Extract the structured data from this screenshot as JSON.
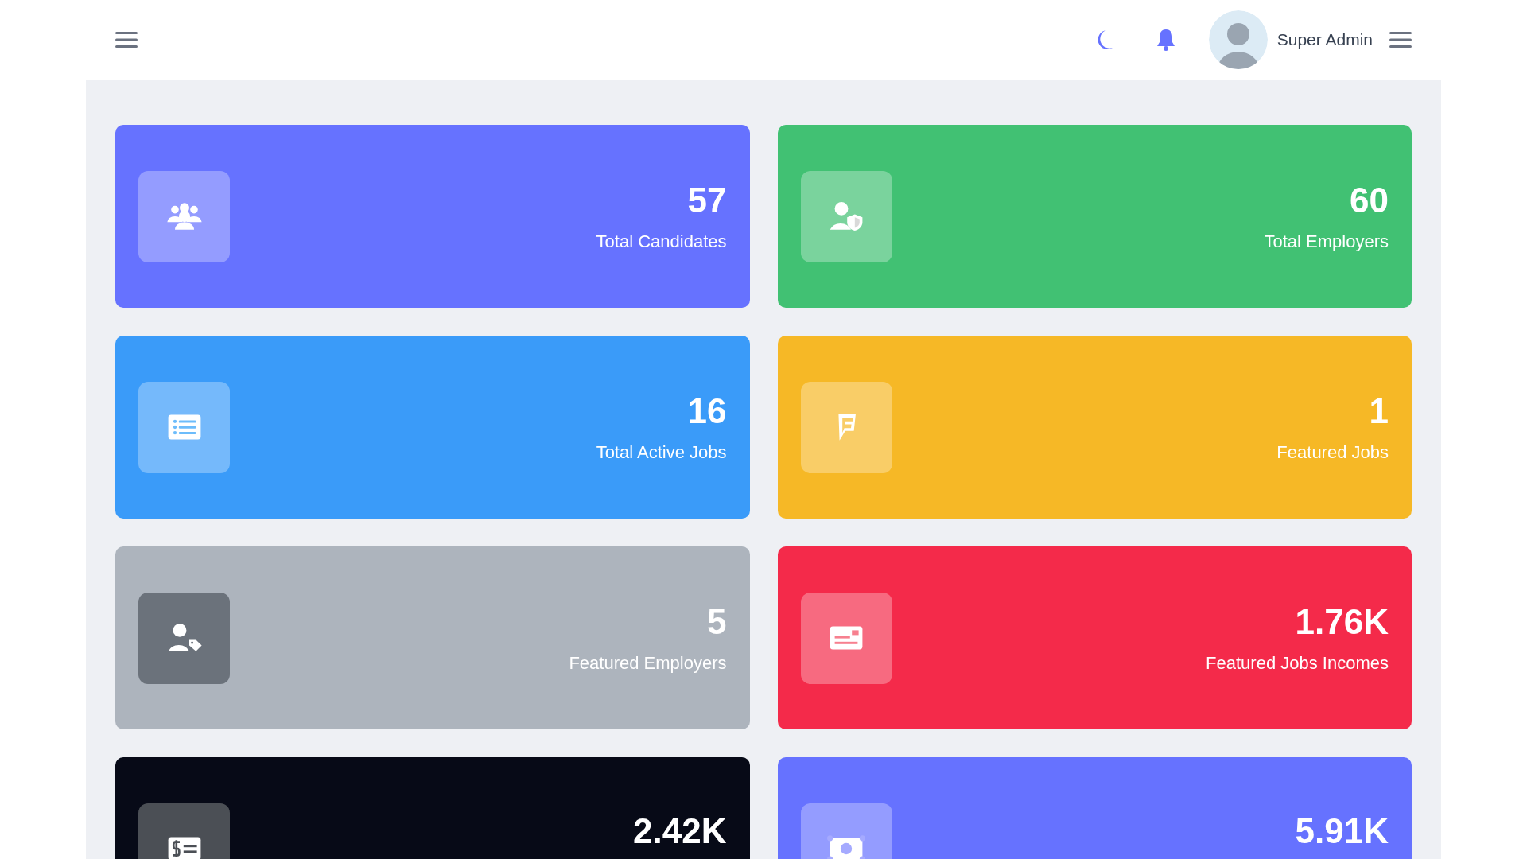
{
  "header": {
    "user_name": "Super Admin"
  },
  "cards": [
    {
      "value": "57",
      "label": "Total Candidates",
      "color": "#6672ff",
      "kind": "users"
    },
    {
      "value": "60",
      "label": "Total Employers",
      "color": "#41c173",
      "kind": "user-shield"
    },
    {
      "value": "16",
      "label": "Total Active Jobs",
      "color": "#3a9bf9",
      "kind": "list"
    },
    {
      "value": "1",
      "label": "Featured Jobs",
      "color": "#f6b826",
      "kind": "flag"
    },
    {
      "value": "5",
      "label": "Featured Employers",
      "color": "#adb4bd",
      "kind": "user-tag"
    },
    {
      "value": "1.76K",
      "label": "Featured Jobs Incomes",
      "color": "#f42a4a",
      "kind": "card"
    },
    {
      "value": "2.42K",
      "color": "#070a17",
      "kind": "dollar-list"
    },
    {
      "value": "5.91K",
      "color": "#6672ff",
      "kind": "money"
    }
  ]
}
